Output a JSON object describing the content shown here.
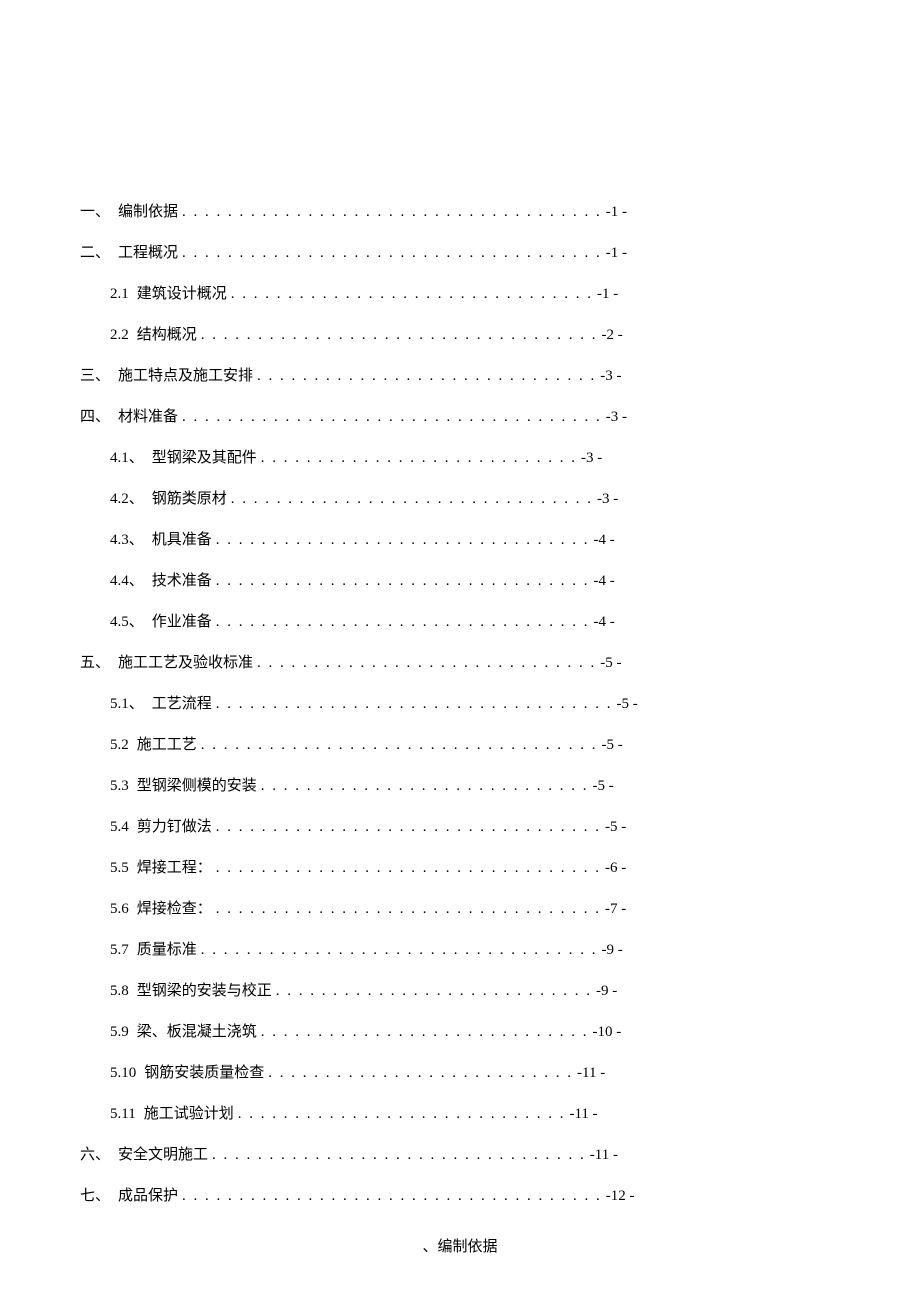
{
  "toc": [
    {
      "level": 1,
      "number": "一、",
      "title": "编制依据",
      "dots": ". . . . . . . . . . . . . . . . . . . . . . . . . . . . . . . . . . . . .",
      "page": "-1 -"
    },
    {
      "level": 1,
      "number": "二、",
      "title": "工程概况",
      "dots": ". . . . . . . . . . . . . . . . . . . . . . . . . . . . . . . . . . . . .",
      "page": "-1 -"
    },
    {
      "level": 2,
      "number": "2.1",
      "title": "建筑设计概况",
      "dots": ". . . . . . . . . . . . . . . . . . . . . . . . . . . . . . . .",
      "page": "-1 -"
    },
    {
      "level": 2,
      "number": "2.2",
      "title": "结构概况",
      "dots": ". . . . . . . . . . . . . . . . . . . . . . . . . . . . . . . . . . .",
      "page": "-2 -"
    },
    {
      "level": 1,
      "number": "三、",
      "title": "施工特点及施工安排",
      "dots": ". . . . . . . . . . . . . . . . . . . . . . . . . . . . . .",
      "page": "-3 -"
    },
    {
      "level": 1,
      "number": "四、",
      "title": "材料准备",
      "dots": ". . . . . . . . . . . . . . . . . . . . . . . . . . . . . . . . . . . . .",
      "page": "-3 -"
    },
    {
      "level": 2,
      "number": "4.1、",
      "title": "型钢梁及其配件",
      "dots": ". . . . . . . . . . . . . . . . . . . . . . . . . . . .",
      "page": "-3 -"
    },
    {
      "level": 2,
      "number": "4.2、",
      "title": "钢筋类原材",
      "dots": ". . . . . . . . . . . . . . . . . . . . . . . . . . . . . . . .",
      "page": "-3 -"
    },
    {
      "level": 2,
      "number": "4.3、",
      "title": "机具准备",
      "dots": ". . . . . . . . . . . . . . . . . . . . . . . . . . . . . . . . .",
      "page": "-4 -"
    },
    {
      "level": 2,
      "number": "4.4、",
      "title": "技术准备",
      "dots": ". . . . . . . . . . . . . . . . . . . . . . . . . . . . . . . . .",
      "page": "-4 -"
    },
    {
      "level": 2,
      "number": "4.5、",
      "title": "作业准备",
      "dots": ". . . . . . . . . . . . . . . . . . . . . . . . . . . . . . . . .",
      "page": "-4 -"
    },
    {
      "level": 1,
      "number": "五、",
      "title": "施工工艺及验收标准",
      "dots": ". . . . . . . . . . . . . . . . . . . . . . . . . . . . . .",
      "page": "-5 -"
    },
    {
      "level": 2,
      "number": "5.1、",
      "title": "工艺流程",
      "dots": ". . . . . . . . . . . . . . . . . . . . . . . . . . . . . . . . . . .",
      "page": "-5 -"
    },
    {
      "level": 2,
      "number": "5.2",
      "title": "施工工艺",
      "dots": ". . . . . . . . . . . . . . . . . . . . . . . . . . . . . . . . . . .",
      "page": "-5 -"
    },
    {
      "level": 2,
      "number": "5.3",
      "title": "型钢梁侧模的安装",
      "dots": ". . . . . . . . . . . . . . . . . . . . . . . . . . . . .",
      "page": "-5 -"
    },
    {
      "level": 2,
      "number": "5.4",
      "title": "剪力钉做法",
      "dots": ". . . . . . . . . . . . . . . . . . . . . . . . . . . . . . . . . .",
      "page": "-5 -"
    },
    {
      "level": 2,
      "number": "5.5",
      "title": "焊接工程：",
      "dots": ". . . . . . . . . . . . . . . . . . . . . . . . . . . . . . . . . .",
      "page": "-6 -"
    },
    {
      "level": 2,
      "number": "5.6",
      "title": "焊接检查：",
      "dots": ". . . . . . . . . . . . . . . . . . . . . . . . . . . . . . . . . .",
      "page": "-7 -"
    },
    {
      "level": 2,
      "number": "5.7",
      "title": "质量标准",
      "dots": ". . . . . . . . . . . . . . . . . . . . . . . . . . . . . . . . . . .",
      "page": "-9 -"
    },
    {
      "level": 2,
      "number": "5.8",
      "title": "型钢梁的安装与校正",
      "dots": ". . . . . . . . . . . . . . . . . . . . . . . . . . . .",
      "page": "-9 -"
    },
    {
      "level": 2,
      "number": "5.9",
      "title": "梁、板混凝土浇筑",
      "dots": ". . . . . . . . . . . . . . . . . . . . . . . . . . . . .",
      "page": "-10 -"
    },
    {
      "level": 2,
      "number": "5.10",
      "title": "钢筋安装质量检查",
      "dots": ". . . . . . . . . . . . . . . . . . . . . . . . . . .",
      "page": "-11 -"
    },
    {
      "level": 2,
      "number": "5.11",
      "title": "施工试验计划",
      "dots": ". . . . . . . . . . . . . . . . . . . . . . . . . . . . .",
      "page": "-11 -"
    },
    {
      "level": 1,
      "number": "六、",
      "title": "安全文明施工",
      "dots": ". . . . . . . . . . . . . . . . . . . . . . . . . . . . . . . . .",
      "page": "-11 -"
    },
    {
      "level": 1,
      "number": "七、",
      "title": "成品保护",
      "dots": ". . . . . . . . . . . . . . . . . . . . . . . . . . . . . . . . . . . . .",
      "page": "-12 -"
    }
  ],
  "heading": "、编制依据"
}
